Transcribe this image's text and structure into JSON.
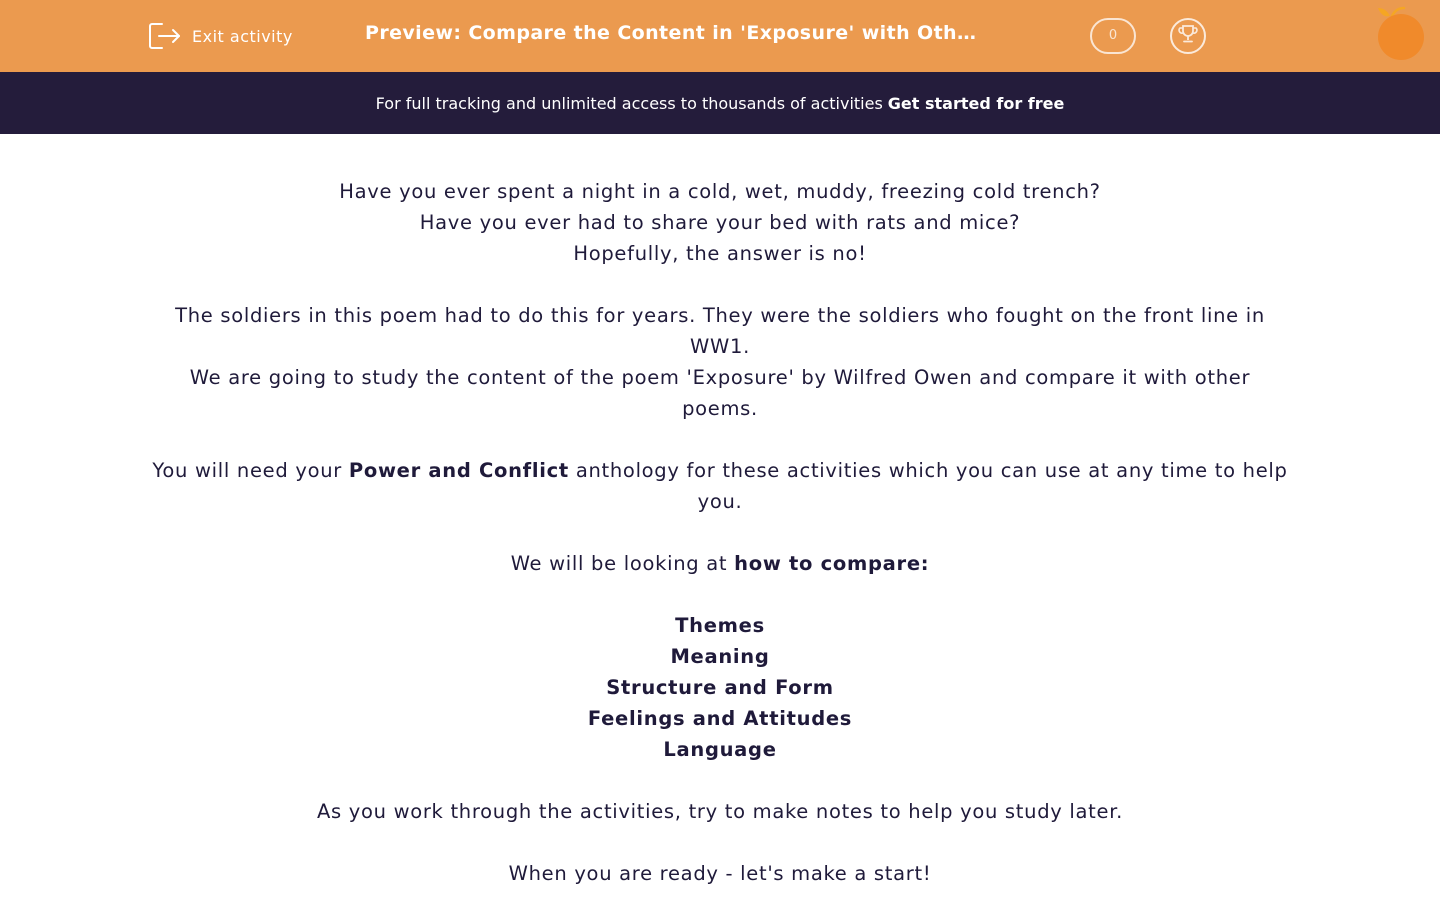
{
  "header": {
    "exit_label": "Exit activity",
    "title": "Preview: Compare the Content in 'Exposure' with Other Po...",
    "score": "0",
    "icons": {
      "exit": "exit-icon",
      "trophy": "trophy-icon",
      "logo": "orange-logo"
    },
    "colors": {
      "header_bg": "#eb9a4f",
      "banner_bg": "#241c3b",
      "text": "#1f1a3a"
    }
  },
  "banner": {
    "text": "For full tracking and unlimited access to thousands of activities",
    "cta": "Get started for free"
  },
  "content": {
    "intro": [
      "Have you ever spent a night in a cold, wet, muddy, freezing cold trench?",
      "Have you ever had to share your bed with rats and mice?",
      "Hopefully, the answer is no!"
    ],
    "soldiers": "The soldiers in this poem had to do this for years.  They were the soldiers who fought on the front line in WW1.",
    "study": "We are going to study the content of the poem 'Exposure' by Wilfred Owen and compare it with other poems.",
    "anthology_pre": "You will need your ",
    "anthology_bold": "Power and Conflict",
    "anthology_post": " anthology for these activities which you can use at any time to help you.",
    "looking_pre": "We will be looking at ",
    "looking_bold": "how to compare:",
    "topics": [
      "Themes",
      "Meaning",
      "Structure and Form",
      "Feelings and Attitudes",
      "Language"
    ],
    "notes": "As you work through the activities, try to make notes to help you study later.",
    "ready": "When you are ready - let's make a start!"
  }
}
